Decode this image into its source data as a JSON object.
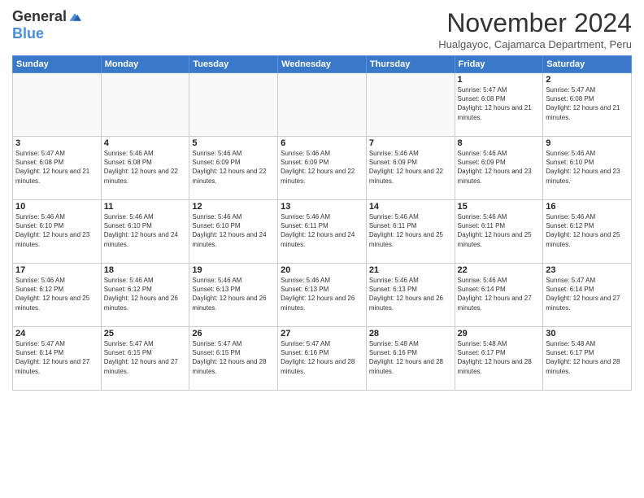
{
  "logo": {
    "general": "General",
    "blue": "Blue"
  },
  "title": {
    "month": "November 2024",
    "location": "Hualgayoc, Cajamarca Department, Peru"
  },
  "weekdays": [
    "Sunday",
    "Monday",
    "Tuesday",
    "Wednesday",
    "Thursday",
    "Friday",
    "Saturday"
  ],
  "weeks": [
    [
      {
        "day": "",
        "info": ""
      },
      {
        "day": "",
        "info": ""
      },
      {
        "day": "",
        "info": ""
      },
      {
        "day": "",
        "info": ""
      },
      {
        "day": "",
        "info": ""
      },
      {
        "day": "1",
        "info": "Sunrise: 5:47 AM\nSunset: 6:08 PM\nDaylight: 12 hours and 21 minutes."
      },
      {
        "day": "2",
        "info": "Sunrise: 5:47 AM\nSunset: 6:08 PM\nDaylight: 12 hours and 21 minutes."
      }
    ],
    [
      {
        "day": "3",
        "info": "Sunrise: 5:47 AM\nSunset: 6:08 PM\nDaylight: 12 hours and 21 minutes."
      },
      {
        "day": "4",
        "info": "Sunrise: 5:46 AM\nSunset: 6:08 PM\nDaylight: 12 hours and 22 minutes."
      },
      {
        "day": "5",
        "info": "Sunrise: 5:46 AM\nSunset: 6:09 PM\nDaylight: 12 hours and 22 minutes."
      },
      {
        "day": "6",
        "info": "Sunrise: 5:46 AM\nSunset: 6:09 PM\nDaylight: 12 hours and 22 minutes."
      },
      {
        "day": "7",
        "info": "Sunrise: 5:46 AM\nSunset: 6:09 PM\nDaylight: 12 hours and 22 minutes."
      },
      {
        "day": "8",
        "info": "Sunrise: 5:46 AM\nSunset: 6:09 PM\nDaylight: 12 hours and 23 minutes."
      },
      {
        "day": "9",
        "info": "Sunrise: 5:46 AM\nSunset: 6:10 PM\nDaylight: 12 hours and 23 minutes."
      }
    ],
    [
      {
        "day": "10",
        "info": "Sunrise: 5:46 AM\nSunset: 6:10 PM\nDaylight: 12 hours and 23 minutes."
      },
      {
        "day": "11",
        "info": "Sunrise: 5:46 AM\nSunset: 6:10 PM\nDaylight: 12 hours and 24 minutes."
      },
      {
        "day": "12",
        "info": "Sunrise: 5:46 AM\nSunset: 6:10 PM\nDaylight: 12 hours and 24 minutes."
      },
      {
        "day": "13",
        "info": "Sunrise: 5:46 AM\nSunset: 6:11 PM\nDaylight: 12 hours and 24 minutes."
      },
      {
        "day": "14",
        "info": "Sunrise: 5:46 AM\nSunset: 6:11 PM\nDaylight: 12 hours and 25 minutes."
      },
      {
        "day": "15",
        "info": "Sunrise: 5:46 AM\nSunset: 6:11 PM\nDaylight: 12 hours and 25 minutes."
      },
      {
        "day": "16",
        "info": "Sunrise: 5:46 AM\nSunset: 6:12 PM\nDaylight: 12 hours and 25 minutes."
      }
    ],
    [
      {
        "day": "17",
        "info": "Sunrise: 5:46 AM\nSunset: 6:12 PM\nDaylight: 12 hours and 25 minutes."
      },
      {
        "day": "18",
        "info": "Sunrise: 5:46 AM\nSunset: 6:12 PM\nDaylight: 12 hours and 26 minutes."
      },
      {
        "day": "19",
        "info": "Sunrise: 5:46 AM\nSunset: 6:13 PM\nDaylight: 12 hours and 26 minutes."
      },
      {
        "day": "20",
        "info": "Sunrise: 5:46 AM\nSunset: 6:13 PM\nDaylight: 12 hours and 26 minutes."
      },
      {
        "day": "21",
        "info": "Sunrise: 5:46 AM\nSunset: 6:13 PM\nDaylight: 12 hours and 26 minutes."
      },
      {
        "day": "22",
        "info": "Sunrise: 5:46 AM\nSunset: 6:14 PM\nDaylight: 12 hours and 27 minutes."
      },
      {
        "day": "23",
        "info": "Sunrise: 5:47 AM\nSunset: 6:14 PM\nDaylight: 12 hours and 27 minutes."
      }
    ],
    [
      {
        "day": "24",
        "info": "Sunrise: 5:47 AM\nSunset: 6:14 PM\nDaylight: 12 hours and 27 minutes."
      },
      {
        "day": "25",
        "info": "Sunrise: 5:47 AM\nSunset: 6:15 PM\nDaylight: 12 hours and 27 minutes."
      },
      {
        "day": "26",
        "info": "Sunrise: 5:47 AM\nSunset: 6:15 PM\nDaylight: 12 hours and 28 minutes."
      },
      {
        "day": "27",
        "info": "Sunrise: 5:47 AM\nSunset: 6:16 PM\nDaylight: 12 hours and 28 minutes."
      },
      {
        "day": "28",
        "info": "Sunrise: 5:48 AM\nSunset: 6:16 PM\nDaylight: 12 hours and 28 minutes."
      },
      {
        "day": "29",
        "info": "Sunrise: 5:48 AM\nSunset: 6:17 PM\nDaylight: 12 hours and 28 minutes."
      },
      {
        "day": "30",
        "info": "Sunrise: 5:48 AM\nSunset: 6:17 PM\nDaylight: 12 hours and 28 minutes."
      }
    ]
  ]
}
